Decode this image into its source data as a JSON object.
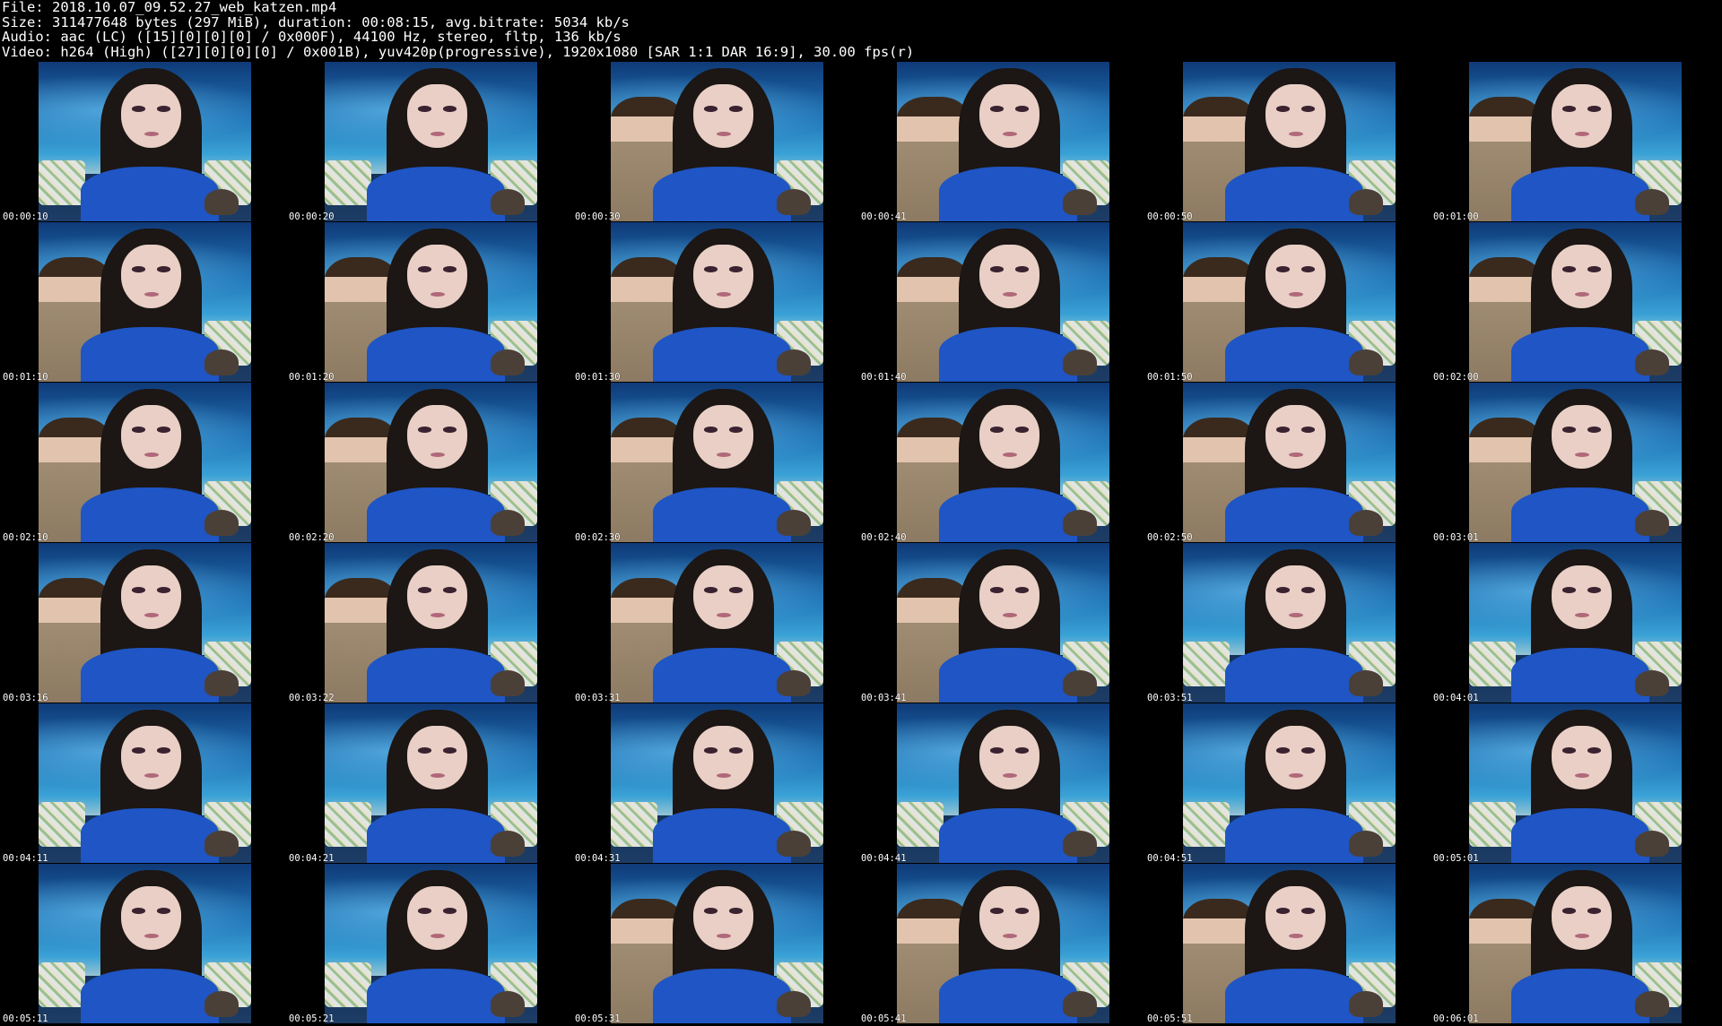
{
  "header": {
    "file_line": "File: 2018.10.07_09.52.27_web_katzen.mp4",
    "size_line": "Size: 311477648 bytes (297 MiB), duration: 00:08:15, avg.bitrate: 5034 kb/s",
    "audio_line": "Audio: aac (LC) ([15][0][0][0] / 0x000F), 44100 Hz, stereo, fltp, 136 kb/s",
    "video_line": "Video: h264 (High) ([27][0][0][0] / 0x001B), yuv420p(progressive), 1920x1080 [SAR 1:1 DAR 16:9], 30.00 fps(r)"
  },
  "colors": {
    "background": "#000000",
    "text": "#ffffff",
    "shirt": "#1f55c4",
    "backdrop": "#2b88c8"
  },
  "thumbnails": [
    {
      "timestamp": "00:00:10",
      "companion": false
    },
    {
      "timestamp": "00:00:20",
      "companion": false
    },
    {
      "timestamp": "00:00:30",
      "companion": true
    },
    {
      "timestamp": "00:00:41",
      "companion": true
    },
    {
      "timestamp": "00:00:50",
      "companion": true
    },
    {
      "timestamp": "00:01:00",
      "companion": true
    },
    {
      "timestamp": "00:01:10",
      "companion": true
    },
    {
      "timestamp": "00:01:20",
      "companion": true
    },
    {
      "timestamp": "00:01:30",
      "companion": true
    },
    {
      "timestamp": "00:01:40",
      "companion": true
    },
    {
      "timestamp": "00:01:50",
      "companion": true
    },
    {
      "timestamp": "00:02:00",
      "companion": true
    },
    {
      "timestamp": "00:02:10",
      "companion": true
    },
    {
      "timestamp": "00:02:20",
      "companion": true
    },
    {
      "timestamp": "00:02:30",
      "companion": true
    },
    {
      "timestamp": "00:02:40",
      "companion": true
    },
    {
      "timestamp": "00:02:50",
      "companion": true
    },
    {
      "timestamp": "00:03:01",
      "companion": true
    },
    {
      "timestamp": "00:03:16",
      "companion": true
    },
    {
      "timestamp": "00:03:22",
      "companion": true
    },
    {
      "timestamp": "00:03:31",
      "companion": true
    },
    {
      "timestamp": "00:03:41",
      "companion": true
    },
    {
      "timestamp": "00:03:51",
      "companion": false
    },
    {
      "timestamp": "00:04:01",
      "companion": false
    },
    {
      "timestamp": "00:04:11",
      "companion": false
    },
    {
      "timestamp": "00:04:21",
      "companion": false
    },
    {
      "timestamp": "00:04:31",
      "companion": false
    },
    {
      "timestamp": "00:04:41",
      "companion": false
    },
    {
      "timestamp": "00:04:51",
      "companion": false
    },
    {
      "timestamp": "00:05:01",
      "companion": false
    },
    {
      "timestamp": "00:05:11",
      "companion": false
    },
    {
      "timestamp": "00:05:21",
      "companion": false
    },
    {
      "timestamp": "00:05:31",
      "companion": true
    },
    {
      "timestamp": "00:05:41",
      "companion": true
    },
    {
      "timestamp": "00:05:51",
      "companion": true
    },
    {
      "timestamp": "00:06:01",
      "companion": true
    }
  ]
}
